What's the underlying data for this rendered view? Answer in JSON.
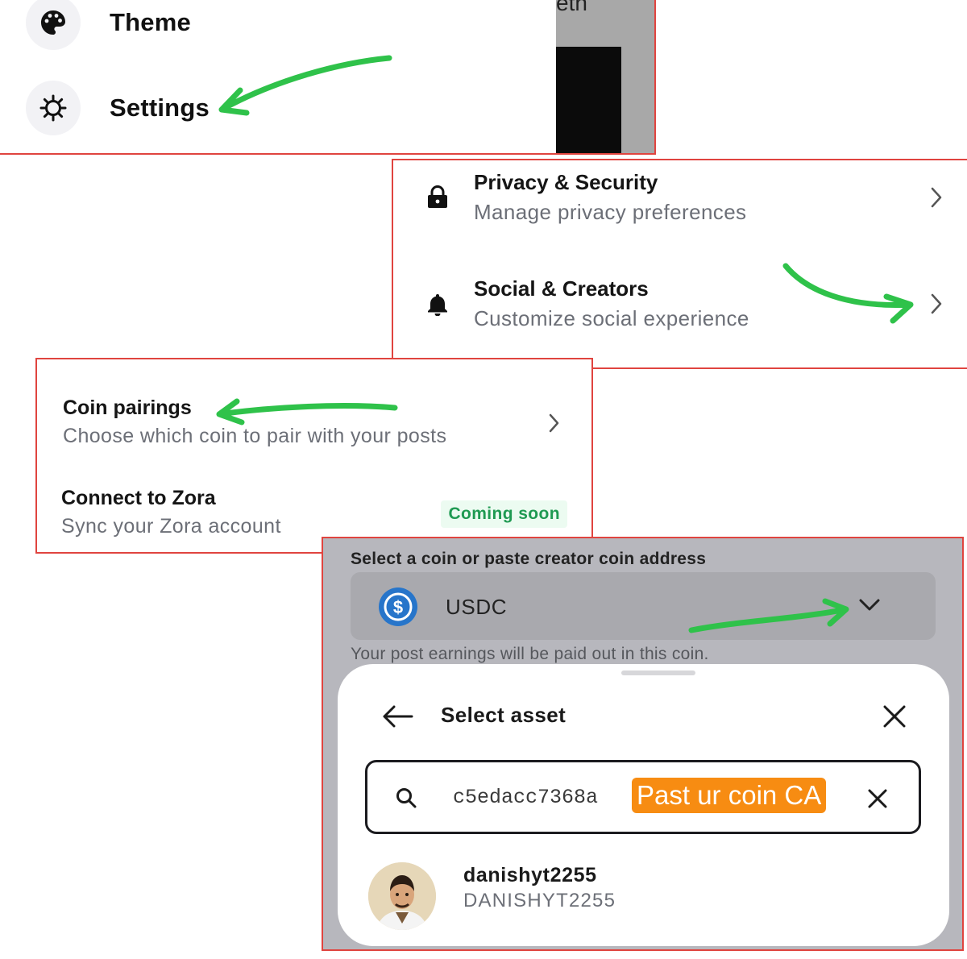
{
  "menu": {
    "items": [
      {
        "label": "Theme",
        "icon": "palette-icon"
      },
      {
        "label": "Settings",
        "icon": "gear-icon"
      }
    ],
    "background_text": "eth"
  },
  "settings": {
    "items": [
      {
        "title": "Privacy & Security",
        "subtitle": "Manage privacy preferences",
        "icon": "lock-icon"
      },
      {
        "title": "Social & Creators",
        "subtitle": "Customize social experience",
        "icon": "bell-icon"
      }
    ]
  },
  "social": {
    "items": [
      {
        "title": "Coin pairings",
        "subtitle": "Choose which coin to pair with your posts"
      },
      {
        "title": "Connect to Zora",
        "subtitle": "Sync your Zora account",
        "badge": "Coming soon"
      }
    ]
  },
  "coin_select": {
    "label": "Select a coin or paste creator coin address",
    "selected": "USDC",
    "note": "Your post earnings will be paid out in this coin."
  },
  "asset_sheet": {
    "title": "Select asset",
    "search_value": "c5edacc7368a",
    "callout": "Past ur coin CA",
    "result": {
      "name": "danishyt2255",
      "symbol": "DANISHYT2255"
    }
  },
  "colors": {
    "panel_border": "#e0443f",
    "annotation_arrow": "#2fc24a",
    "callout_bg": "#f78c12",
    "badge_text": "#1f9a52",
    "usdc_blue": "#2775ca"
  }
}
